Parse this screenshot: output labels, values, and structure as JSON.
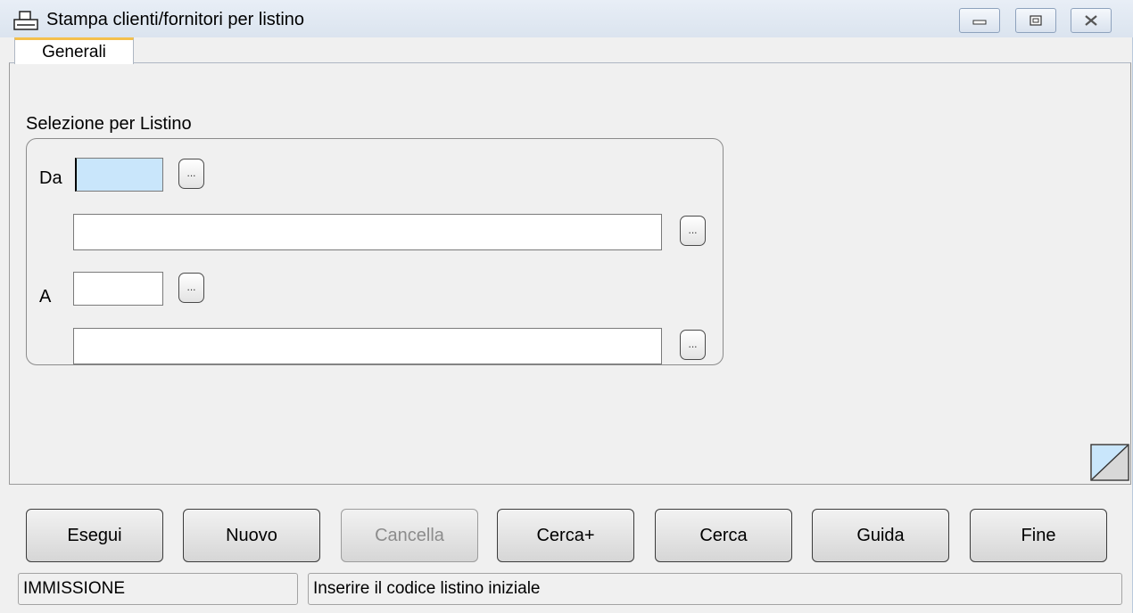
{
  "window": {
    "title": "Stampa clienti/fornitori per listino",
    "icons": [
      "printer-icon",
      "minimize-icon",
      "maximize-icon",
      "close-icon"
    ]
  },
  "tabs": [
    {
      "label": "Generali",
      "active": true
    }
  ],
  "selection": {
    "group_label": "Selezione per Listino",
    "from_label": "Da",
    "to_label": "A",
    "ellipsis": "...",
    "from_code": "",
    "from_description": "",
    "to_code": "",
    "to_description": ""
  },
  "buttons": [
    {
      "label": "Esegui",
      "enabled": true
    },
    {
      "label": "Nuovo",
      "enabled": true
    },
    {
      "label": "Cancella",
      "enabled": false
    },
    {
      "label": "Cerca+",
      "enabled": true
    },
    {
      "label": "Cerca",
      "enabled": true
    },
    {
      "label": "Guida",
      "enabled": true
    },
    {
      "label": "Fine",
      "enabled": true
    }
  ],
  "status": {
    "mode": "IMMISSIONE",
    "message": "Inserire il codice listino iniziale"
  },
  "colors": {
    "active_field": "#c9e6fb",
    "tab_accent": "#f4c04c"
  }
}
